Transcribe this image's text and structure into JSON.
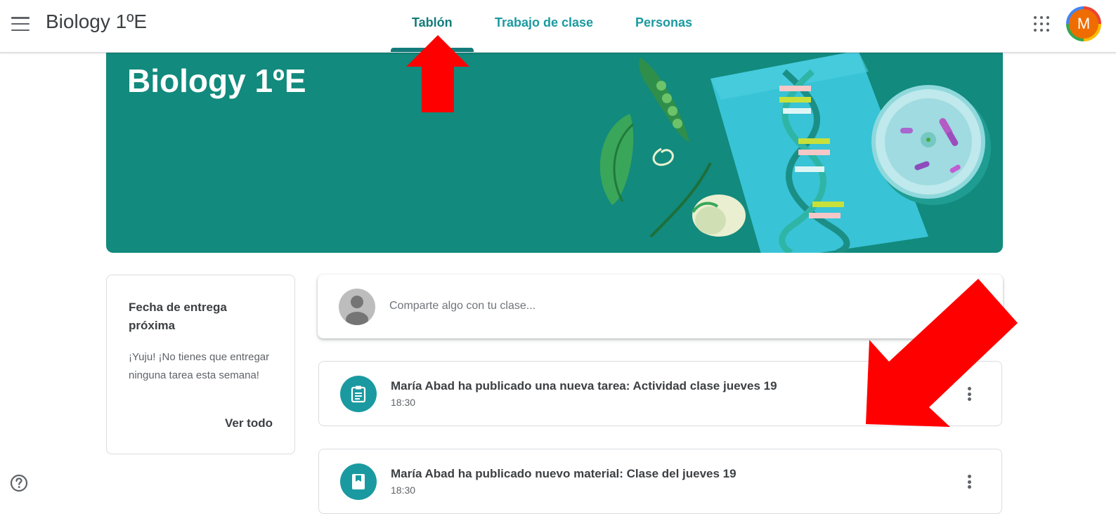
{
  "header": {
    "class_title": "Biology 1ºE",
    "tabs": [
      {
        "label": "Tablón",
        "active": true
      },
      {
        "label": "Trabajo de clase",
        "active": false
      },
      {
        "label": "Personas",
        "active": false
      }
    ],
    "user_initial": "M",
    "accent_color": "#137b7a"
  },
  "banner": {
    "title": "Biology 1ºE",
    "background": "#128a7d"
  },
  "upcoming": {
    "title": "Fecha de entrega próxima",
    "message": "¡Yuju! ¡No tienes que entregar ninguna tarea esta semana!",
    "view_all": "Ver todo"
  },
  "share": {
    "placeholder": "Comparte algo con tu clase..."
  },
  "stream": [
    {
      "icon": "assignment-icon",
      "title": "María Abad ha publicado una nueva tarea: Actividad clase jueves 19",
      "time": "18:30"
    },
    {
      "icon": "material-icon",
      "title": "María Abad ha publicado nuevo material: Clase del jueves 19",
      "time": "18:30"
    }
  ],
  "annotations": {
    "arrow_color": "#ff0000"
  }
}
